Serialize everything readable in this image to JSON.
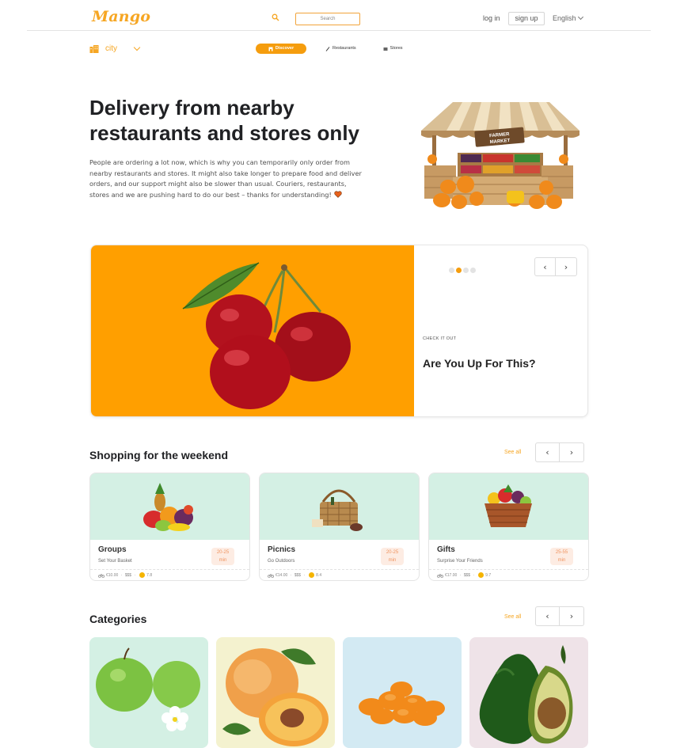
{
  "header": {
    "logo": "Mango",
    "search_placeholder": "Search",
    "login": "log in",
    "signup": "sign up",
    "language": "English"
  },
  "subnav": {
    "city": "city",
    "tabs": [
      {
        "label": "Discover",
        "active": true
      },
      {
        "label": "Restaurants",
        "active": false
      },
      {
        "label": "Stores",
        "active": false
      }
    ]
  },
  "hero": {
    "title": "Delivery from nearby restaurants and stores only",
    "body": "People are ordering a lot now, which is why you can temporarily only order from nearby restaurants and stores. It might also take longer to prepare food and deliver orders, and our support might also be slower than usual. Couriers, restaurants, stores and we are pushing hard to do our best – thanks for understanding!",
    "market_sign": "FARMER MARKET"
  },
  "carousel": {
    "eyebrow": "CHECK IT OUT",
    "title": "Are You Up For This?",
    "slide_count": 4,
    "active_slide": 1
  },
  "weekend": {
    "title": "Shopping for the weekend",
    "see_all": "See all",
    "cards": [
      {
        "title": "Groups",
        "subtitle": "Set Your Basket",
        "time": "20-25",
        "unit": "min",
        "fee": "€10.00",
        "price": "$$$",
        "rating": "7.8"
      },
      {
        "title": "Picnics",
        "subtitle": "Go Outdoors",
        "time": "20-25",
        "unit": "min",
        "fee": "€14.00",
        "price": "$$$",
        "rating": "8.4"
      },
      {
        "title": "Gifts",
        "subtitle": "Surprise Your Friends",
        "time": "25-55",
        "unit": "min",
        "fee": "€17.00",
        "price": "$$$",
        "rating": "9.7"
      }
    ]
  },
  "categories": {
    "title": "Categories",
    "see_all": "See all",
    "items": [
      {
        "icon": "apple-icon",
        "bg": "#d4f0e4"
      },
      {
        "icon": "peach-icon",
        "bg": "#f4f2cf"
      },
      {
        "icon": "dried-apricot-icon",
        "bg": "#d3eaf3"
      },
      {
        "icon": "avocado-icon",
        "bg": "#efe3e8"
      }
    ]
  },
  "colors": {
    "brand": "#f6a623",
    "carousel_bg": "#ff9f00"
  }
}
